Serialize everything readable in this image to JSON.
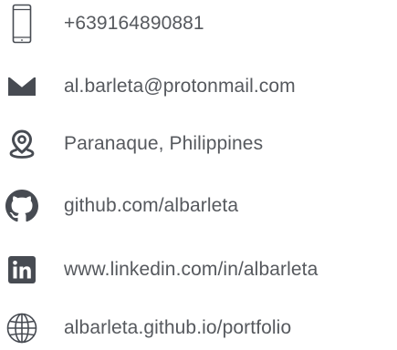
{
  "contacts": {
    "phone": {
      "text": "+639164890881",
      "icon": "phone-icon"
    },
    "email": {
      "text": "al.barleta@protonmail.com",
      "icon": "envelope-icon"
    },
    "location": {
      "text": "Paranaque, Philippines",
      "icon": "map-pin-icon"
    },
    "github": {
      "text": "github.com/albarleta",
      "icon": "github-icon"
    },
    "linkedin": {
      "text": "www.linkedin.com/in/albarleta",
      "icon": "linkedin-icon"
    },
    "website": {
      "text": "albarleta.github.io/portfolio",
      "icon": "globe-icon"
    }
  },
  "colors": {
    "text": "#56595e",
    "icon": "#474b52"
  }
}
